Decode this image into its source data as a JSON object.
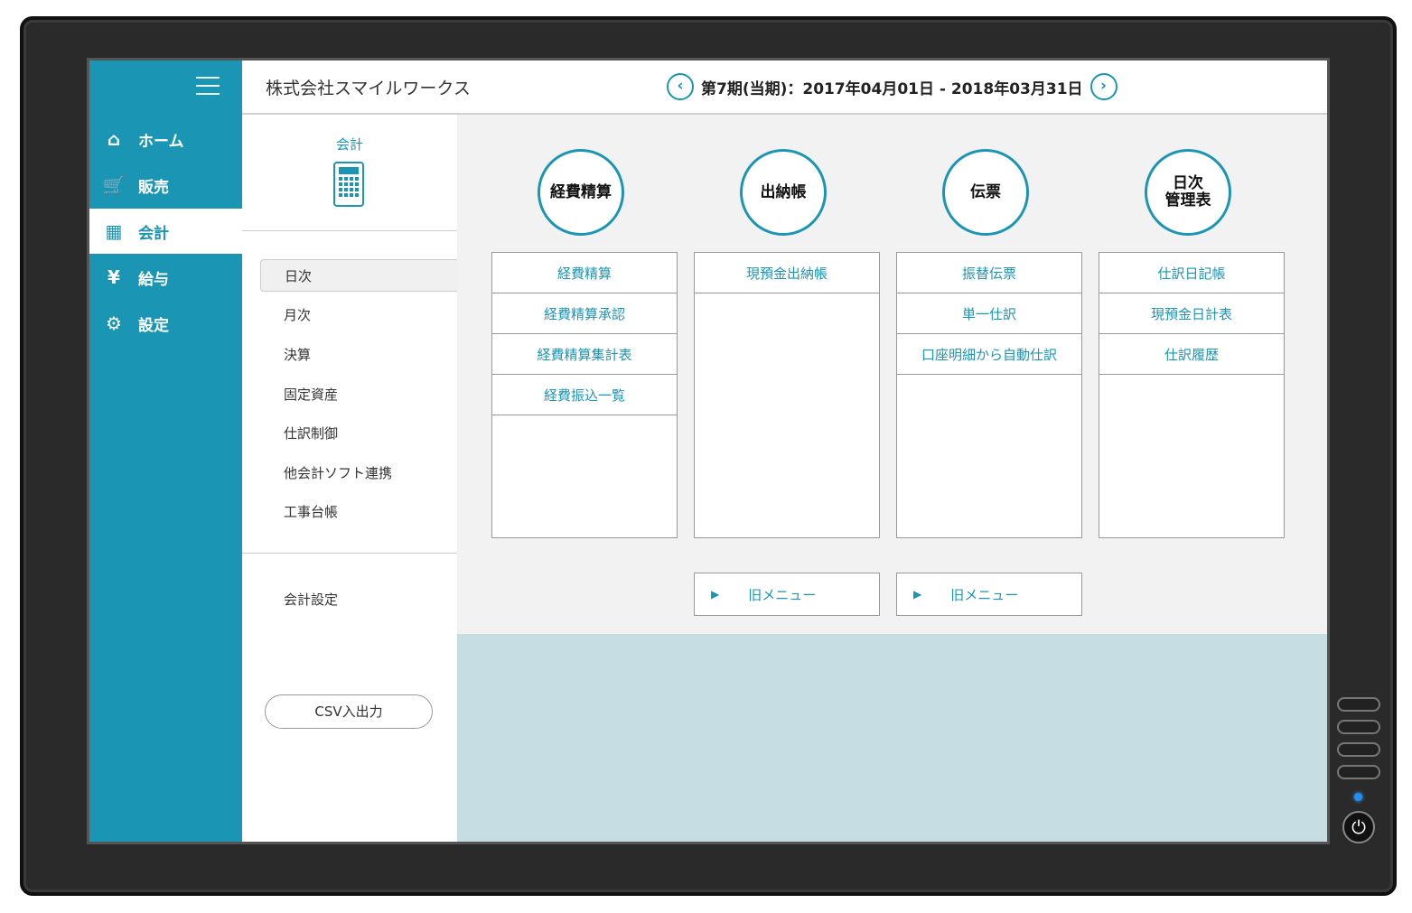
{
  "header": {
    "company": "株式会社スマイルワークス",
    "period": "第7期(当期)：2017年04月01日 - 2018年03月31日"
  },
  "nav": {
    "items": [
      {
        "label": "ホーム",
        "icon": "home-icon"
      },
      {
        "label": "販売",
        "icon": "cart-icon"
      },
      {
        "label": "会計",
        "icon": "calculator-icon"
      },
      {
        "label": "給与",
        "icon": "money-bag-icon"
      },
      {
        "label": "設定",
        "icon": "gear-icon"
      }
    ],
    "active": "会計"
  },
  "submenu": {
    "title": "会計",
    "items": [
      "日次",
      "月次",
      "決算",
      "固定資産",
      "仕訳制御",
      "他会計ソフト連携",
      "工事台帳"
    ],
    "settings": "会計設定",
    "csv_button": "CSV入出力"
  },
  "columns": [
    {
      "title": "経費精算",
      "links": [
        "経費精算",
        "経費精算承認",
        "経費精算集計表",
        "経費振込一覧"
      ]
    },
    {
      "title": "出納帳",
      "links": [
        "現預金出納帳"
      ]
    },
    {
      "title": "伝票",
      "links": [
        "振替伝票",
        "単一仕訳",
        "口座明細から自動仕訳"
      ]
    },
    {
      "title_line1": "日次",
      "title_line2": "管理表",
      "links": [
        "仕訳日記帳",
        "現預金日計表",
        "仕訳履歴"
      ]
    }
  ],
  "old_menu": {
    "label": "旧メニュー"
  },
  "colors": {
    "accent": "#1b95b4",
    "background": "#f2f2f2",
    "lower_panel": "#c6dde3"
  }
}
